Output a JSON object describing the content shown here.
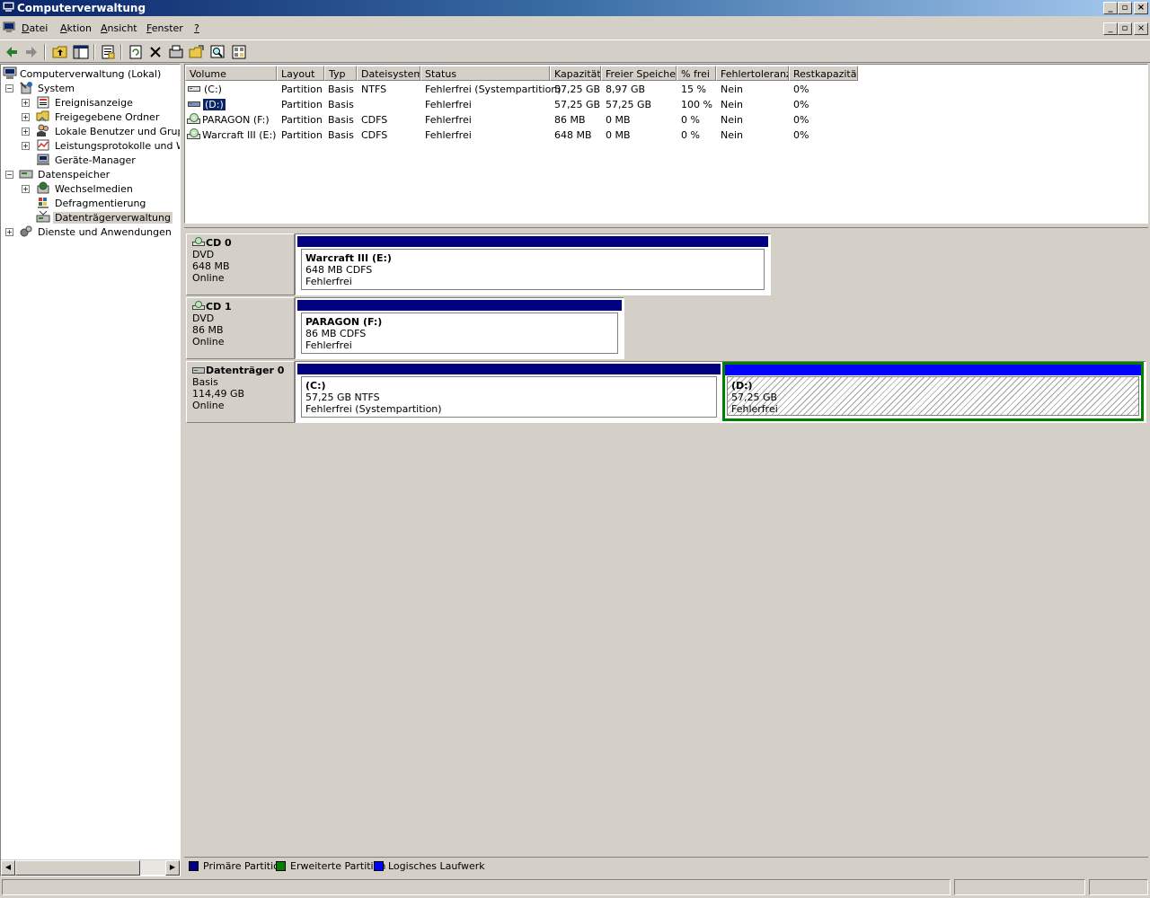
{
  "window": {
    "title": "Computerverwaltung",
    "controls": {
      "minimize": "_",
      "restore": "▫",
      "close": "×"
    }
  },
  "menubar": {
    "items": [
      {
        "label": "Datei",
        "accel": "D",
        "rest": "atei"
      },
      {
        "label": "Aktion",
        "accel": "A",
        "rest": "ktion"
      },
      {
        "label": "Ansicht",
        "accel": "A",
        "rest": "nsicht"
      },
      {
        "label": "Fenster",
        "accel": "F",
        "rest": "enster"
      },
      {
        "label": "?",
        "accel": "?",
        "rest": ""
      }
    ]
  },
  "toolbar": {
    "buttons": [
      "back-icon",
      "forward-icon",
      "up-folder-icon",
      "show-hide-tree-icon",
      "properties-icon",
      "refresh-icon",
      "delete-icon",
      "settings-icon",
      "open-icon",
      "search-icon",
      "help-icon"
    ]
  },
  "tree": {
    "root": "Computerverwaltung (Lokal)",
    "items": [
      {
        "label": "System",
        "level": 1,
        "expander": "−"
      },
      {
        "label": "Ereignisanzeige",
        "level": 2,
        "expander": "+"
      },
      {
        "label": "Freigegebene Ordner",
        "level": 2,
        "expander": "+"
      },
      {
        "label": "Lokale Benutzer und Gruppen",
        "level": 2,
        "expander": "+"
      },
      {
        "label": "Leistungsprotokolle und Warnungen",
        "level": 2,
        "expander": "+"
      },
      {
        "label": "Geräte-Manager",
        "level": 2,
        "expander": ""
      },
      {
        "label": "Datenspeicher",
        "level": 1,
        "expander": "−"
      },
      {
        "label": "Wechselmedien",
        "level": 2,
        "expander": "+"
      },
      {
        "label": "Defragmentierung",
        "level": 2,
        "expander": ""
      },
      {
        "label": "Datenträgerverwaltung",
        "level": 2,
        "expander": "",
        "selected": true
      },
      {
        "label": "Dienste und Anwendungen",
        "level": 1,
        "expander": "+"
      }
    ]
  },
  "volume_list": {
    "columns": [
      "Volume",
      "Layout",
      "Typ",
      "Dateisystem",
      "Status",
      "Kapazität",
      "Freier Speicher",
      "% frei",
      "Fehlertoleranz",
      "Restkapazität"
    ],
    "rows": [
      {
        "volume": "(C:)",
        "layout": "Partition",
        "typ": "Basis",
        "fs": "NTFS",
        "status": "Fehlerfrei (Systempartition)",
        "kap": "57,25 GB",
        "frei": "8,97 GB",
        "pct": "15 %",
        "ft": "Nein",
        "rest": "0%",
        "icon": "drive-icon"
      },
      {
        "volume": "(D:)",
        "layout": "Partition",
        "typ": "Basis",
        "fs": "",
        "status": "Fehlerfrei",
        "kap": "57,25 GB",
        "frei": "57,25 GB",
        "pct": "100 %",
        "ft": "Nein",
        "rest": "0%",
        "icon": "drive-icon",
        "selected": true
      },
      {
        "volume": "PARAGON (F:)",
        "layout": "Partition",
        "typ": "Basis",
        "fs": "CDFS",
        "status": "Fehlerfrei",
        "kap": "86 MB",
        "frei": "0 MB",
        "pct": "0 %",
        "ft": "Nein",
        "rest": "0%",
        "icon": "cd-icon"
      },
      {
        "volume": "Warcraft III (E:)",
        "layout": "Partition",
        "typ": "Basis",
        "fs": "CDFS",
        "status": "Fehlerfrei",
        "kap": "648 MB",
        "frei": "0 MB",
        "pct": "0 %",
        "ft": "Nein",
        "rest": "0%",
        "icon": "cd-icon"
      }
    ]
  },
  "disks": [
    {
      "name": "CD 0",
      "type": "DVD",
      "size": "648 MB",
      "state": "Online",
      "icon": "cd-drive-icon",
      "partitions": [
        {
          "name": "Warcraft III  (E:)",
          "detail": "648 MB CDFS",
          "status": "Fehlerfrei",
          "kind": "primary"
        }
      ]
    },
    {
      "name": "CD 1",
      "type": "DVD",
      "size": "86 MB",
      "state": "Online",
      "icon": "cd-drive-icon",
      "partitions": [
        {
          "name": "PARAGON  (F:)",
          "detail": "86 MB CDFS",
          "status": "Fehlerfrei",
          "kind": "primary"
        }
      ]
    },
    {
      "name": "Datenträger 0",
      "type": "Basis",
      "size": "114,49 GB",
      "state": "Online",
      "icon": "hard-disk-icon",
      "partitions": [
        {
          "name": "(C:)",
          "detail": "57,25 GB NTFS",
          "status": "Fehlerfrei (Systempartition)",
          "kind": "primary"
        },
        {
          "name": "(D:)",
          "detail": "57,25 GB",
          "status": "Fehlerfrei",
          "kind": "logical"
        }
      ]
    }
  ],
  "legend": [
    {
      "label": "Primäre Partition",
      "color": "#000080"
    },
    {
      "label": "Erweiterte Partition",
      "color": "#008000"
    },
    {
      "label": "Logisches Laufwerk",
      "color": "#0000ff"
    }
  ],
  "colors": {
    "primary": "#000080",
    "extended": "#008000",
    "logical": "#0000ff",
    "selection": "#0a246a"
  }
}
